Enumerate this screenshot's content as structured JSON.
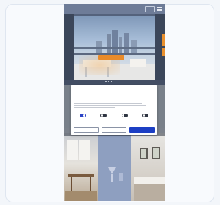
{
  "site": {
    "brand": "",
    "nav": [
      "",
      "",
      "",
      "",
      ""
    ],
    "language": "",
    "hero_cta": ""
  },
  "cookie_dialog": {
    "title": "",
    "logo": "",
    "toggles": [
      {
        "label": "",
        "state": "on"
      },
      {
        "label": "",
        "state": "off"
      },
      {
        "label": "",
        "state": "off"
      },
      {
        "label": "",
        "state": "off"
      }
    ],
    "details_link": "",
    "buttons": {
      "reject": "",
      "allow_selection": "",
      "allow_all": ""
    }
  },
  "colors": {
    "nav_bar": "#6e7c98",
    "accent_orange": "#e98b2a",
    "primary_blue": "#1d3fc4"
  },
  "icons": [
    "menu-icon"
  ]
}
